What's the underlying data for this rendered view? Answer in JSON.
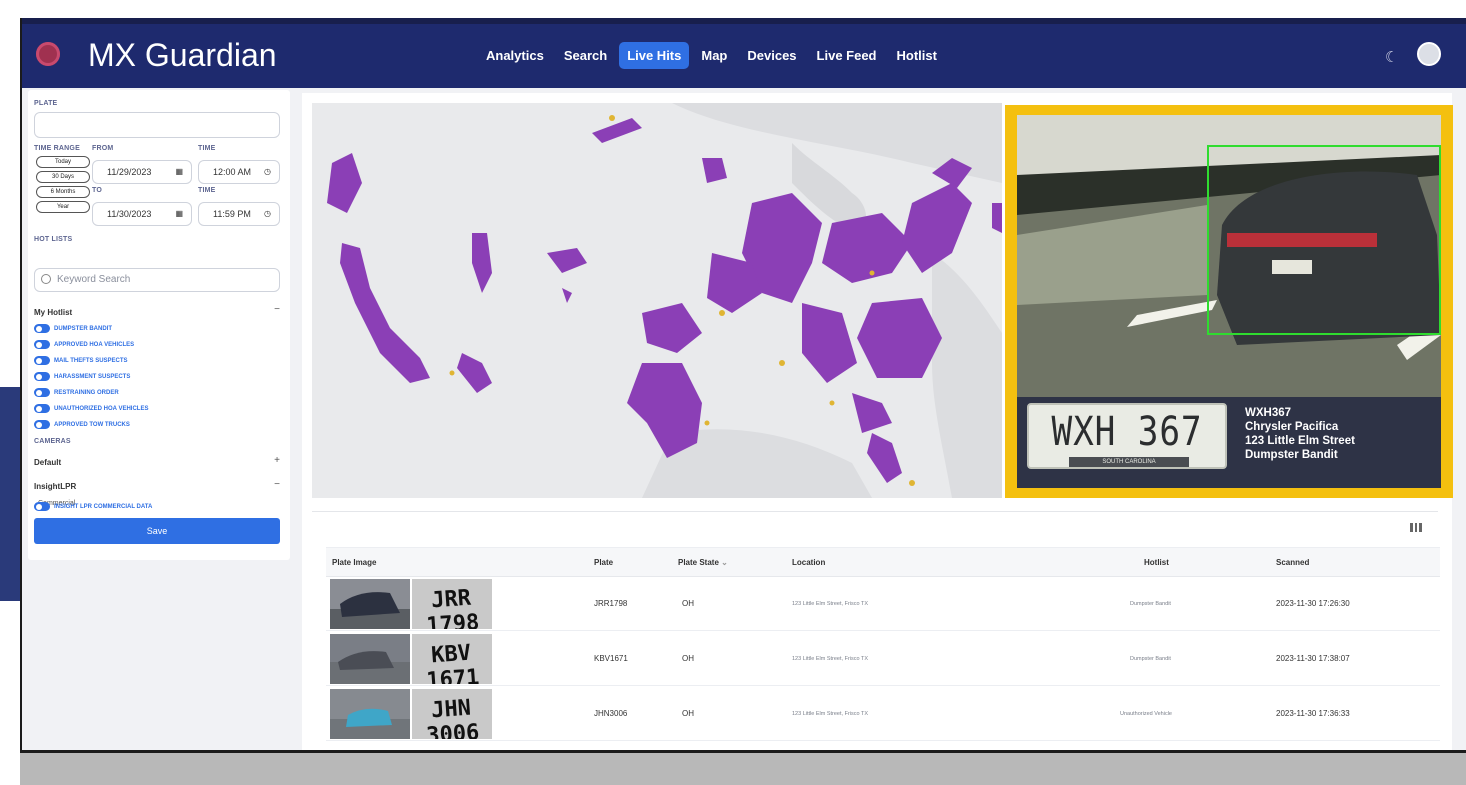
{
  "header": {
    "title": "MX Guardian",
    "nav": [
      "Analytics",
      "Search",
      "Live Hits",
      "Map",
      "Devices",
      "Live Feed",
      "Hotlist"
    ],
    "active_nav": "Live Hits"
  },
  "sidebar": {
    "plate_label": "PLATE",
    "time_range_label": "TIME RANGE",
    "from_label": "FROM",
    "to_label": "TO",
    "time_label": "TIME",
    "ranges": [
      "Today",
      "30 Days",
      "6 Months",
      "Year"
    ],
    "from_date": "11/29/2023",
    "from_time": "12:00 AM",
    "to_date": "11/30/2023",
    "to_time": "11:59 PM",
    "hot_lists_label": "HOT LISTS",
    "keyword_placeholder": "Keyword Search",
    "my_hotlist": {
      "title": "My Hotlist",
      "toggle": "−",
      "items": [
        "DUMPSTER BANDIT",
        "APPROVED HOA VEHICLES",
        "MAIL THEFTS SUSPECTS",
        "HARASSMENT SUSPECTS",
        "RESTRAINING ORDER",
        "UNAUTHORIZED HOA VEHICLES",
        "APPROVED TOW TRUCKS"
      ]
    },
    "cameras_label": "CAMERAS",
    "default_group": {
      "title": "Default",
      "toggle": "+"
    },
    "insight_group": {
      "title": "InsightLPR",
      "toggle": "−",
      "sub": "Commercial",
      "items": [
        "INSIGHT LPR COMMERCIAL DATA"
      ]
    },
    "save_label": "Save"
  },
  "camera": {
    "plate_text": "WXH 367",
    "plate_state_text": "SOUTH CAROLINA",
    "info": [
      "WXH367",
      "Chrysler Pacifica",
      "123 Little Elm Street",
      "Dumpster Bandit"
    ]
  },
  "table": {
    "headers": {
      "plate_image": "Plate Image",
      "plate": "Plate",
      "plate_state": "Plate State",
      "location": "Location",
      "hotlist": "Hotlist",
      "scanned": "Scanned"
    },
    "rows": [
      {
        "plate_img_text": "JRR 1798",
        "plate": "JRR1798",
        "state": "OH",
        "location": "123 Little Elm Street, Frisco TX",
        "hotlist": "Dumpster Bandit",
        "scanned": "2023-11-30 17:26:30"
      },
      {
        "plate_img_text": "KBV 1671",
        "plate": "KBV1671",
        "state": "OH",
        "location": "123 Little Elm Street, Frisco TX",
        "hotlist": "Dumpster Bandit",
        "scanned": "2023-11-30 17:38:07"
      },
      {
        "plate_img_text": "JHN 3006",
        "plate": "JHN3006",
        "state": "OH",
        "location": "123 Little Elm Street, Frisco TX",
        "hotlist": "Unauthorized Vehicle",
        "scanned": "2023-11-30 17:36:33"
      }
    ]
  },
  "colors": {
    "header_bg": "#1e2a6e",
    "accent": "#2f6fe3",
    "map_points": "#8b3fb6",
    "map_points_secondary": "#e0b533",
    "camera_frame": "#f4c00f",
    "detect_box": "#2fdc2f"
  },
  "icons": [
    "moon-icon",
    "avatar",
    "calendar-icon",
    "clock-icon",
    "search-icon",
    "columns-icon",
    "sort-chevron-icon"
  ]
}
